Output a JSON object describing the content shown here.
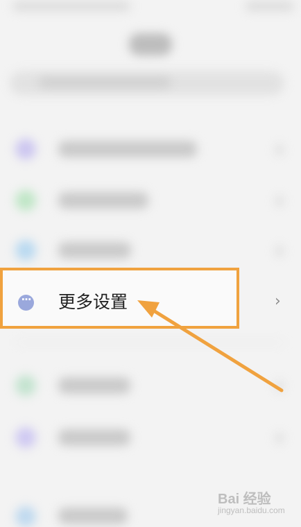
{
  "list": {
    "focused_item": {
      "label": "更多设置",
      "icon": "more-dots-icon",
      "chevron": "›"
    }
  },
  "annotation": {
    "color": "#f0a23f"
  },
  "watermark": {
    "main": "Bai 经验",
    "sub": "jingyan.baidu.com"
  }
}
